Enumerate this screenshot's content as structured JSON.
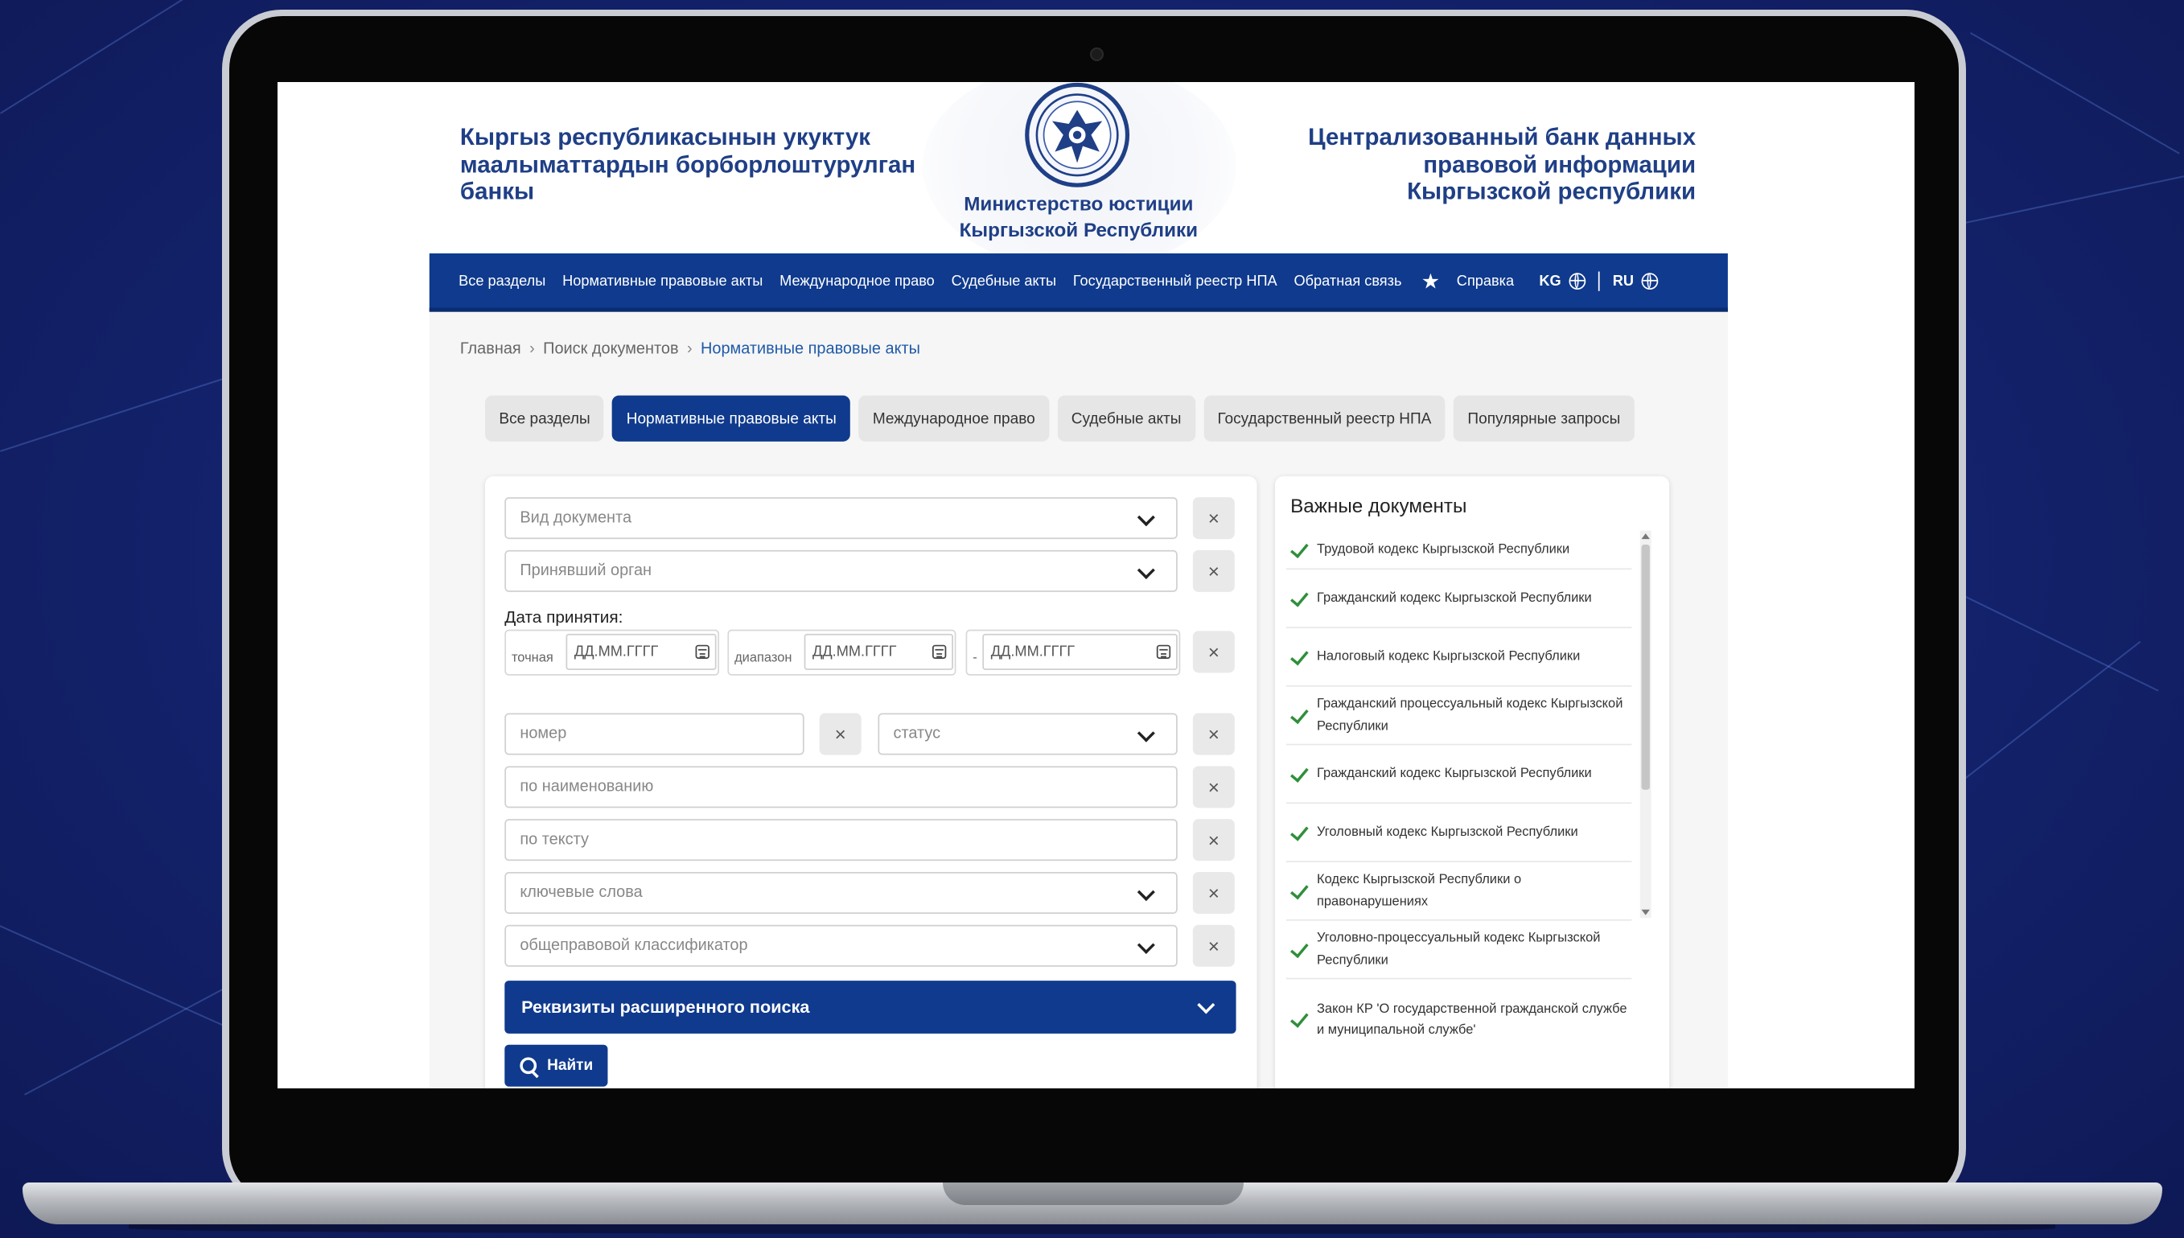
{
  "header": {
    "left_title": "Кыргыз республикасынын укуктук маалыматтардын борборлоштурулган банкы",
    "ministry": "Министерство юстиции Кыргызской Республики",
    "right_title": "Централизованный банк данных правовой информации Кыргызской республики"
  },
  "nav": {
    "items": [
      "Все разделы",
      "Нормативные правовые акты",
      "Международное право",
      "Судебные акты",
      "Государственный реестр НПА",
      "Обратная связь"
    ],
    "help": "Справка",
    "lang_kg": "KG",
    "lang_ru": "RU"
  },
  "breadcrumb": [
    "Главная",
    "Поиск документов",
    "Нормативные правовые акты"
  ],
  "tabs": [
    "Все разделы",
    "Нормативные правовые акты",
    "Международное право",
    "Судебные акты",
    "Государственный реестр НПА",
    "Популярные запросы"
  ],
  "active_tab": 1,
  "form": {
    "doc_type_placeholder": "Вид документа",
    "issuer_placeholder": "Принявший орган",
    "date_label": "Дата принятия:",
    "exact_label": "точная",
    "range_label": "диапазон",
    "range_sep": "-",
    "date_placeholder": "ДД.ММ.ГГГГ",
    "number_placeholder": "номер",
    "status_placeholder": "статус",
    "name_placeholder": "по наименованию",
    "text_placeholder": "по тексту",
    "keywords_placeholder": "ключевые слова",
    "classifier_placeholder": "общеправовой классификатор",
    "advanced_label": "Реквизиты расширенного поиска",
    "find_label": "Найти",
    "clear_symbol": "×"
  },
  "important": {
    "title": "Важные документы",
    "items": [
      "Трудовой кодекс Кыргызской Республики",
      "Гражданский кодекс Кыргызской Республики",
      "Налоговый кодекс Кыргызской Республики",
      "Гражданский процессуальный кодекс Кыргызской Республики",
      "Гражданский кодекс Кыргызской Республики",
      "Уголовный кодекс Кыргызской Республики",
      "Кодекс Кыргызской Республики о правонарушениях",
      "Уголовно-процессуальный кодекс Кыргызской Республики",
      "Закон КР 'О государственной гражданской службе и муниципальной службе'"
    ]
  },
  "colors": {
    "brand_blue": "#0f3a8d",
    "heading_blue": "#1f3f86",
    "check_green": "#2f8f3a",
    "background": "#13226a"
  }
}
